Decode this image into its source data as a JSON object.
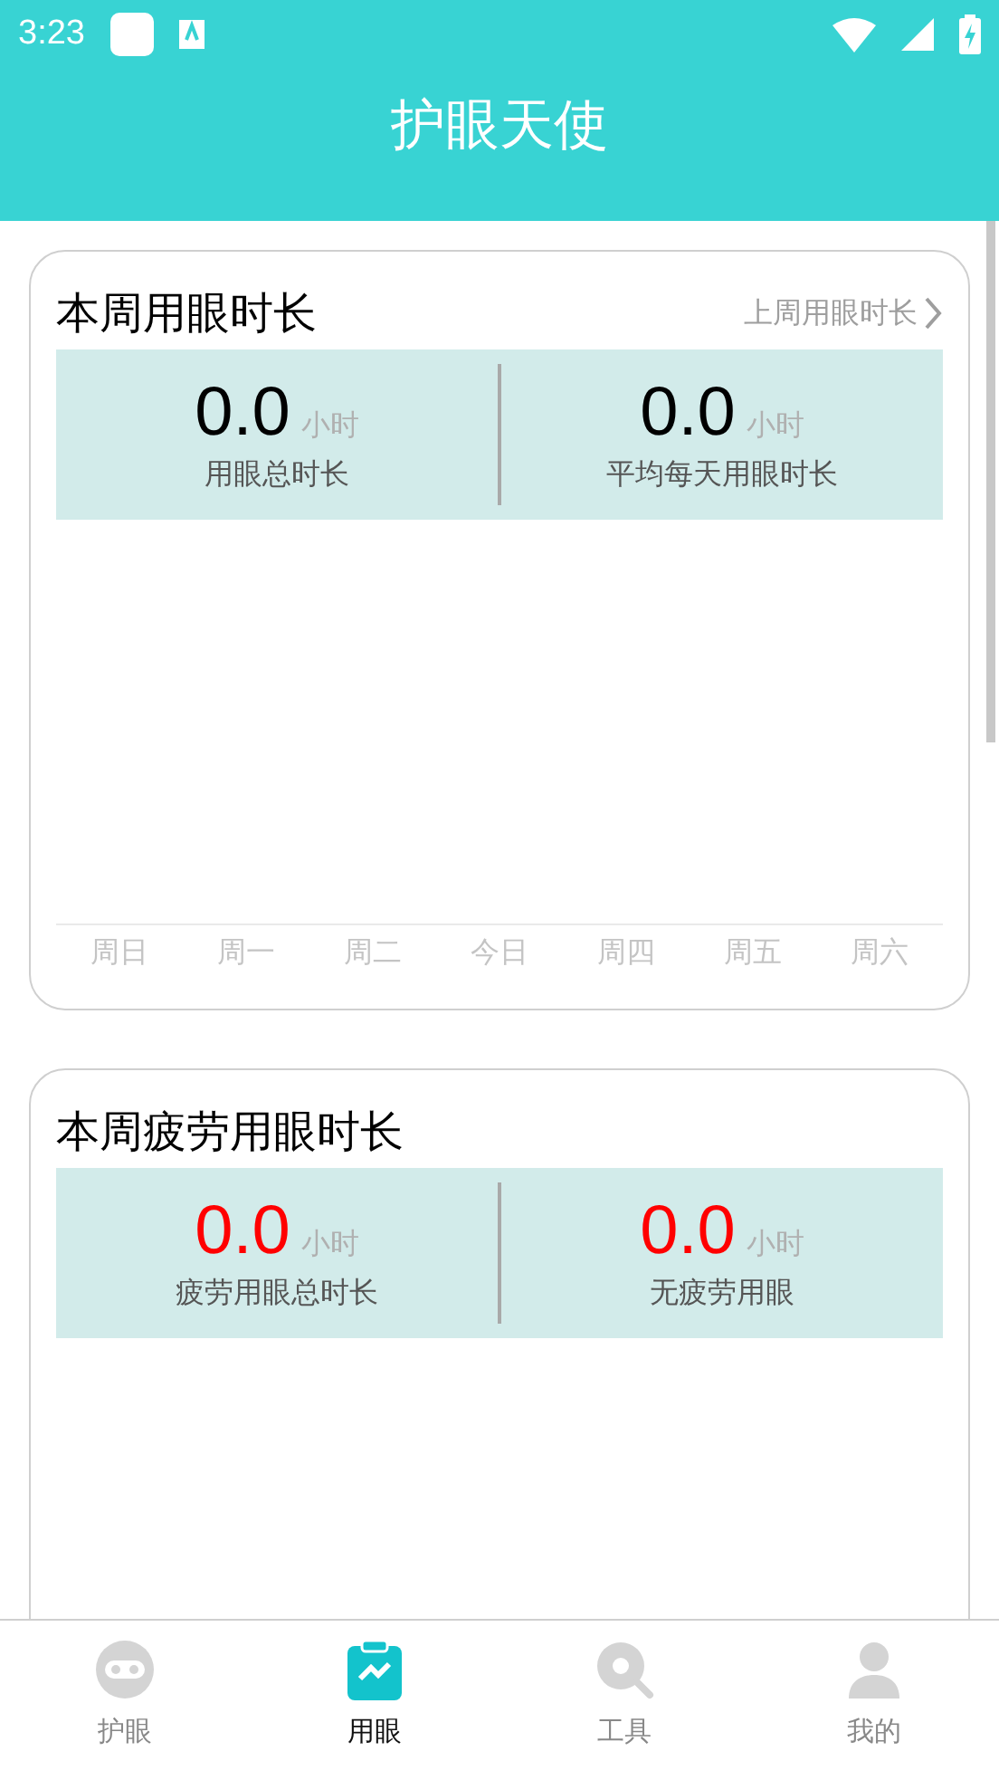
{
  "status_bar": {
    "time": "3:23"
  },
  "header": {
    "title": "护眼天使"
  },
  "cards": [
    {
      "title": "本周用眼时长",
      "link": "上周用眼时长",
      "stats": [
        {
          "value": "0.0",
          "unit": "小时",
          "label": "用眼总时长",
          "color": "#000000"
        },
        {
          "value": "0.0",
          "unit": "小时",
          "label": "平均每天用眼时长",
          "color": "#000000"
        }
      ],
      "weekdays": [
        "周日",
        "周一",
        "周二",
        "今日",
        "周四",
        "周五",
        "周六"
      ]
    },
    {
      "title": "本周疲劳用眼时长",
      "stats": [
        {
          "value": "0.0",
          "unit": "小时",
          "label": "疲劳用眼总时长",
          "color": "#ff0000"
        },
        {
          "value": "0.0",
          "unit": "小时",
          "label": "无疲劳用眼",
          "color": "#ff0000"
        }
      ]
    }
  ],
  "nav": [
    {
      "label": "护眼",
      "selected": false
    },
    {
      "label": "用眼",
      "selected": true
    },
    {
      "label": "工具",
      "selected": false
    },
    {
      "label": "我的",
      "selected": false
    }
  ]
}
